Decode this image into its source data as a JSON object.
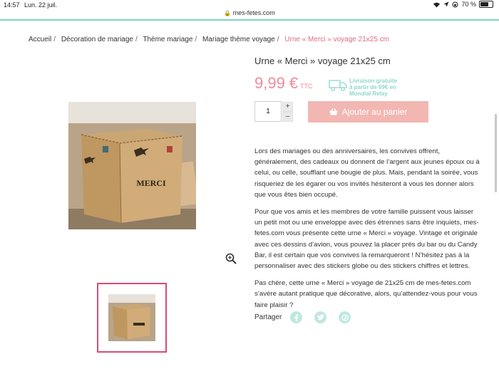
{
  "status_bar": {
    "time": "14:57",
    "date": "Lun. 22 juil.",
    "battery": "70 %",
    "battery_level": 0.7
  },
  "browser": {
    "url": "mes-fetes.com"
  },
  "breadcrumb": [
    {
      "label": "Accueil"
    },
    {
      "label": "Décoration de mariage"
    },
    {
      "label": "Thème mariage"
    },
    {
      "label": "Mariage thème voyage"
    },
    {
      "label": "Urne « Merci » voyage 21x25 cm"
    }
  ],
  "product": {
    "title": "Urne « Merci » voyage 21x25 cm",
    "price": "9,99 €",
    "price_suffix": "TTC",
    "shipping_lines": [
      "Livraison gratuite",
      "à partir de 69€ en",
      "Mondial Relay"
    ],
    "quantity": "1",
    "add_to_cart_label": "Ajouter au panier",
    "box_label": "MERCI"
  },
  "description": [
    "Lors des mariages ou des anniversaires, les convives offrent, généralement, des cadeaux ou donnent de l’argent aux jeunes époux ou à celui, ou celle, soufflant une bougie de plus. Mais, pendant la soirée, vous risqueriez de les égarer ou vos invités hésiteront à vous les donner alors que vous êtes bien occupé.",
    "Pour que vos amis et les membres de votre famille puissent vous laisser un petit mot ou une enveloppe avec des étrennes sans être inquiets, mes-fetes.com vous présente cette urne « Merci » voyage. Vintage et originale avec ces dessins d’avion, vous pouvez la placer près du bar ou du Candy Bar, il est certain que vos convives la remarqueront ! N’hésitez pas à la personnaliser avec des stickers globe ou des stickers chiffres et lettres.",
    "Pas chère, cette urne « Merci » voyage de 21x25 cm de mes-fetes.com s’avère autant pratique que décorative, alors, qu’attendez-vous pour vous faire plaisir ?"
  ],
  "share": {
    "label": "Partager",
    "icons": [
      "facebook-icon",
      "twitter-icon",
      "pinterest-icon"
    ]
  },
  "colors": {
    "accent_pink": "#e06b86",
    "price_pink": "#ef8a9c",
    "button_pink": "#f2b7b2",
    "mint": "#7fd0c2",
    "thumb_border": "#d94b75"
  }
}
